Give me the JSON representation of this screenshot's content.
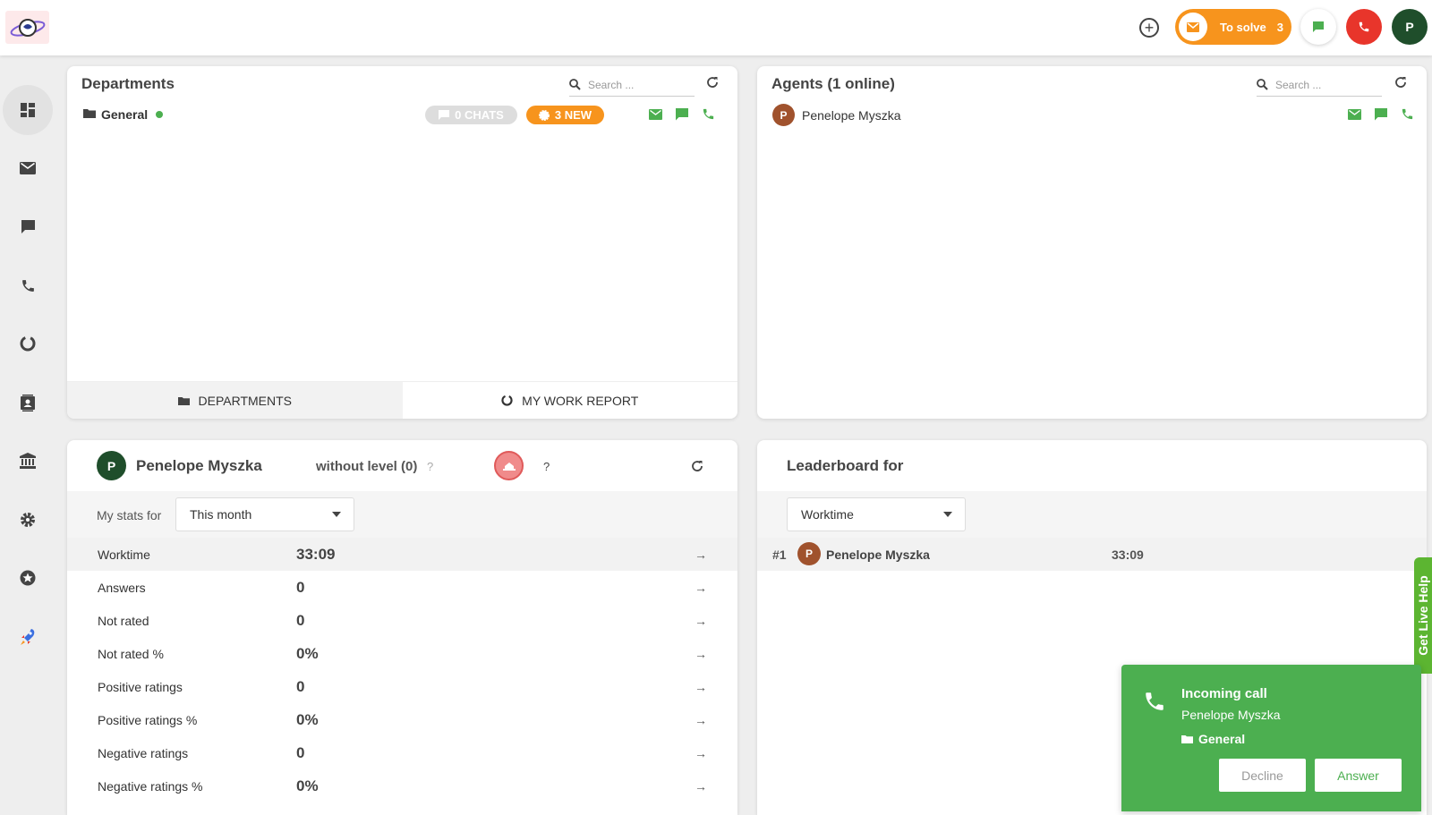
{
  "topbar": {
    "to_solve_label": "To solve",
    "to_solve_count": "3",
    "avatar_letter": "P"
  },
  "sidebar": {
    "items": [
      "dashboard-icon",
      "email-icon",
      "chat-icon",
      "phone-icon",
      "report-icon",
      "contacts-icon",
      "company-icon",
      "settings-icon",
      "star-icon",
      "rocket-icon"
    ]
  },
  "departments": {
    "title": "Departments",
    "search_placeholder": "Search ...",
    "row": {
      "name": "General",
      "chats_badge": "0 CHATS",
      "new_badge": "3 NEW"
    },
    "tabs": [
      "DEPARTMENTS",
      "MY WORK REPORT"
    ]
  },
  "agents": {
    "title": "Agents (1 online)",
    "search_placeholder": "Search ...",
    "row": {
      "avatar": "P",
      "name": "Penelope Myszka"
    }
  },
  "mystats": {
    "avatar": "P",
    "name": "Penelope Myszka",
    "level": "without level (0)",
    "level_help": "?",
    "badge_help": "?",
    "period_label": "My stats for",
    "period_value": "This month",
    "rows": [
      {
        "name": "Worktime",
        "value": "33:09"
      },
      {
        "name": "Answers",
        "value": "0"
      },
      {
        "name": "Not rated",
        "value": "0"
      },
      {
        "name": "Not rated %",
        "value": "0%"
      },
      {
        "name": "Positive ratings",
        "value": "0"
      },
      {
        "name": "Positive ratings %",
        "value": "0%"
      },
      {
        "name": "Negative ratings",
        "value": "0"
      },
      {
        "name": "Negative ratings %",
        "value": "0%"
      }
    ]
  },
  "leaderboard": {
    "title": "Leaderboard for",
    "metric": "Worktime",
    "rows": [
      {
        "rank": "#1",
        "avatar": "P",
        "name": "Penelope Myszka",
        "value": "33:09"
      }
    ]
  },
  "livehelp": {
    "label": "Get Live Help"
  },
  "incoming": {
    "title": "Incoming call",
    "caller": "Penelope Myszka",
    "department": "General",
    "decline": "Decline",
    "answer": "Answer"
  },
  "colors": {
    "accent_orange": "#f7941d",
    "green": "#4caf50",
    "red": "#e8352b",
    "avatar_brown": "#a0522d",
    "avatar_dark_green": "#1f4e2b"
  }
}
